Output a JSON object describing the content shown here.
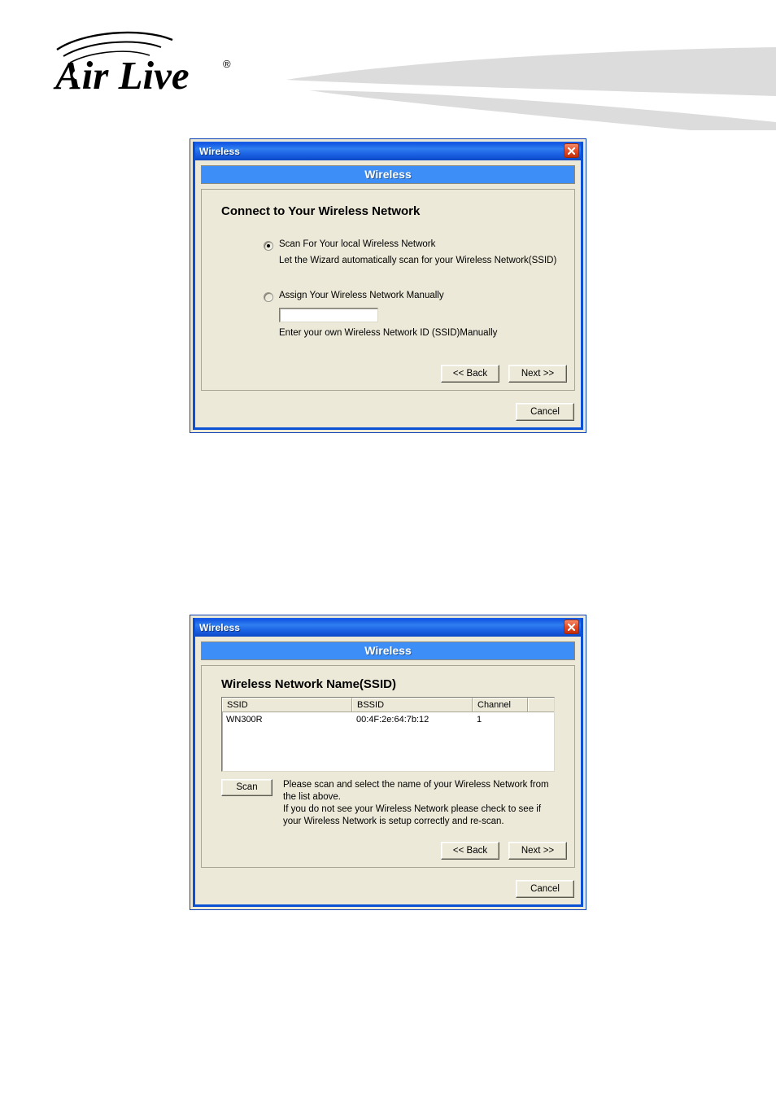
{
  "header": {
    "logo_text": "Air Live",
    "logo_registered_mark": "®"
  },
  "dialog1": {
    "window_title": "Wireless",
    "close_icon": "close-icon",
    "banner_title": "Wireless",
    "heading": "Connect to Your Wireless Network",
    "options": [
      {
        "id": "scan-local",
        "label": "Scan For Your local Wireless Network",
        "selected": true,
        "description": "Let the Wizard automatically scan for your Wireless Network(SSID)"
      },
      {
        "id": "assign-manual",
        "label": "Assign Your Wireless Network Manually",
        "selected": false,
        "description": "Enter your own Wireless Network ID (SSID)Manually"
      }
    ],
    "ssid_input_value": "",
    "ssid_input_placeholder": "",
    "back_label": "<< Back",
    "next_label": "Next >>",
    "cancel_label": "Cancel"
  },
  "dialog2": {
    "window_title": "Wireless",
    "close_icon": "close-icon",
    "banner_title": "Wireless",
    "heading": "Wireless Network Name(SSID)",
    "table": {
      "columns": [
        "SSID",
        "BSSID",
        "Channel",
        ""
      ],
      "rows": [
        [
          "WN300R",
          "00:4F:2e:64:7b:12",
          "1",
          ""
        ]
      ]
    },
    "scan_label": "Scan",
    "scan_note_lines": [
      "Please scan and select the name of your Wireless Network from",
      "the list above.",
      "If you do not see your Wireless Network please check to see if",
      "your Wireless Network is setup correctly and re-scan."
    ],
    "back_label": "<< Back",
    "next_label": "Next >>",
    "cancel_label": "Cancel"
  },
  "colors": {
    "titlebar_blue": "#1457e4",
    "banner_blue": "#3e8ef7",
    "dialog_face": "#ece9d8",
    "frame_blue": "#0b51d6",
    "close_red": "#e8502a",
    "swoosh_gray": "#dcdcdc"
  }
}
